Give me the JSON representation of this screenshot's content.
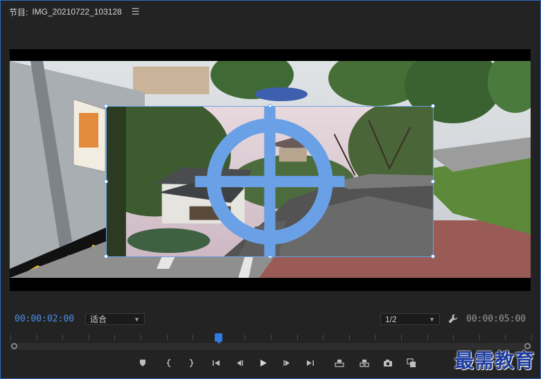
{
  "panel": {
    "title_label": "节目:",
    "sequence_name": "IMG_20210722_103128",
    "menu_icon": "hamburger-icon"
  },
  "transport": {
    "current_time": "00:00:02:00",
    "zoom_value": "适合",
    "resolution_value": "1/2",
    "duration": "00:00:05:00",
    "settings_icon": "wrench-icon"
  },
  "timeline": {
    "playhead_fraction": 0.4
  },
  "toolbar_icons": [
    "add-marker-icon",
    "mark-in-icon",
    "mark-out-icon",
    "go-to-in-icon",
    "step-back-icon",
    "play-icon",
    "step-forward-icon",
    "go-to-out-icon",
    "lift-icon",
    "extract-icon",
    "export-frame-icon",
    "comparison-view-icon"
  ],
  "watermark": "最需教育",
  "colors": {
    "accent": "#2d7be5",
    "timecode_current": "#4a8fe8",
    "panel_border": "#2d6cc4"
  }
}
